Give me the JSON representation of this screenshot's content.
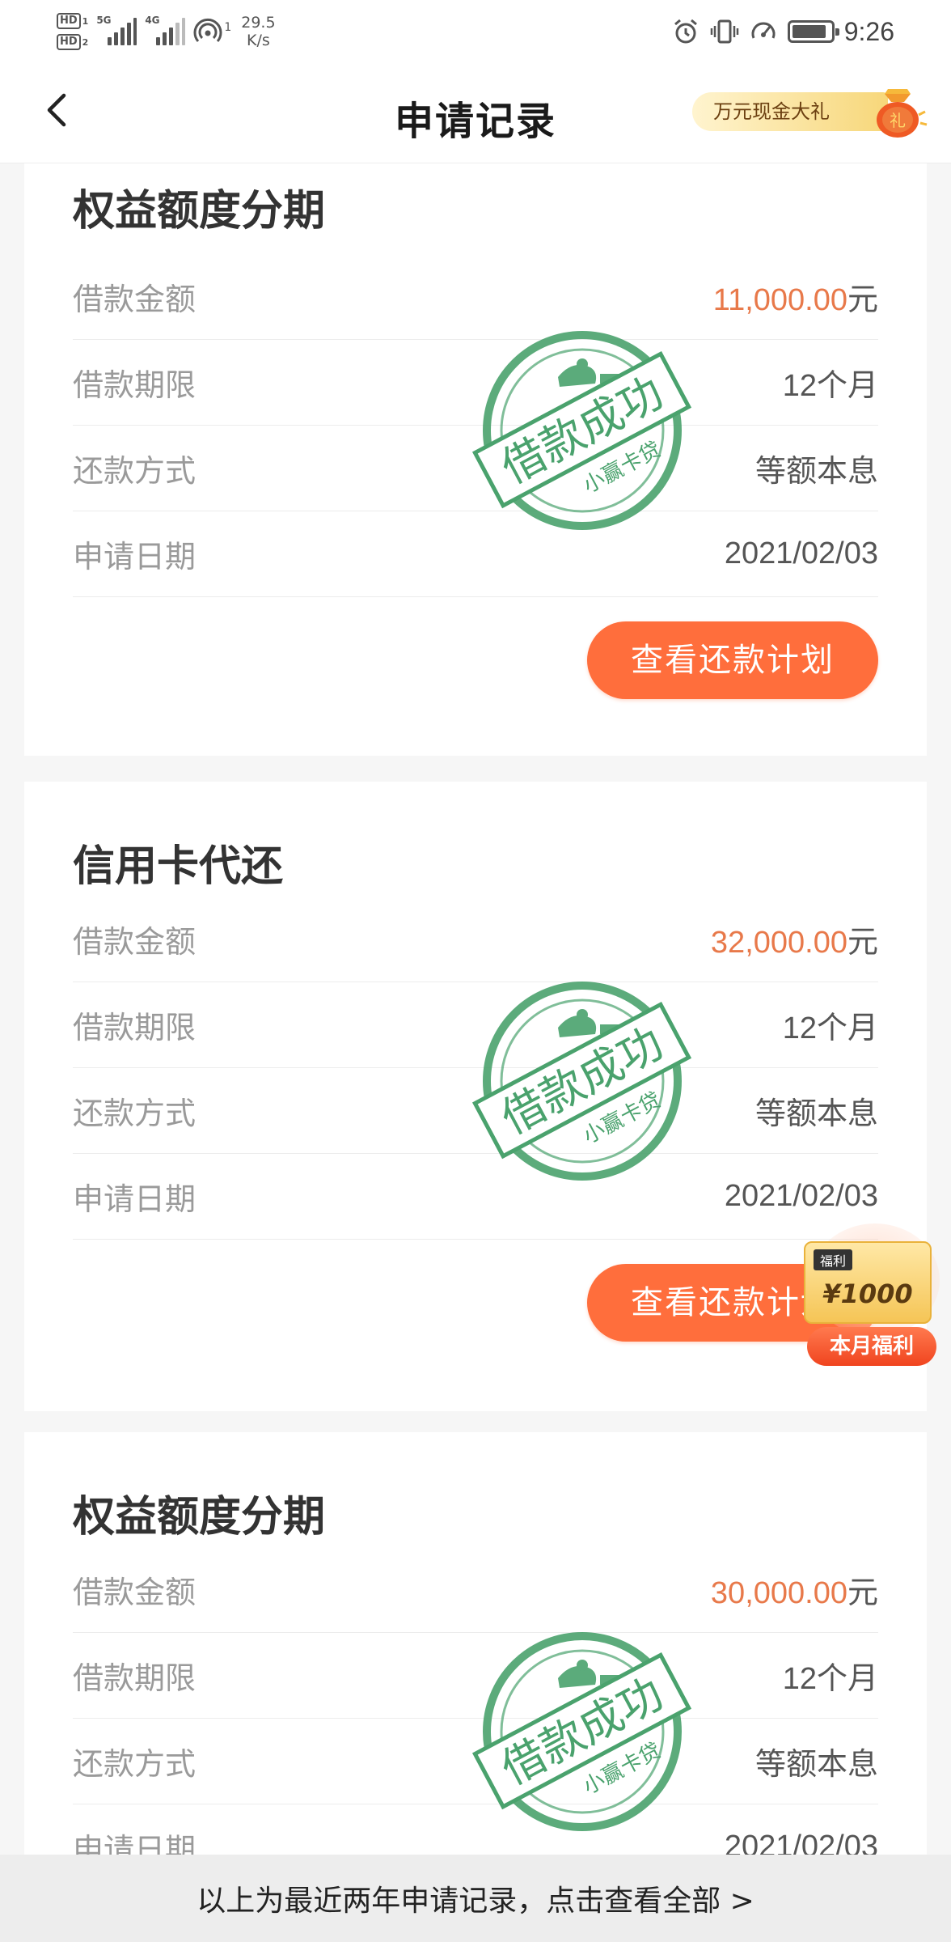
{
  "status_bar": {
    "hd1": "HD",
    "hd1_num": "1",
    "hd2": "HD",
    "hd2_num": "2",
    "net1": "5G",
    "net2": "4G",
    "speed_value": "29.5",
    "speed_unit": "K/s",
    "hotspot_count": "1",
    "battery_level": 0.9,
    "time": "9:26"
  },
  "header": {
    "title": "申请记录",
    "promo_label": "万元现金大礼",
    "promo_bag_char": "礼"
  },
  "labels": {
    "amount": "借款金额",
    "term": "借款期限",
    "method": "还款方式",
    "date": "申请日期",
    "unit": "元",
    "plan_button": "查看还款计划"
  },
  "stamp": {
    "main_text": "借款成功",
    "brand_text": "小赢卡贷",
    "color": "#4aa26d"
  },
  "records": [
    {
      "title": "权益额度分期",
      "amount": "11,000.00",
      "term": "12个月",
      "method": "等额本息",
      "date": "2021/02/03"
    },
    {
      "title": "信用卡代还",
      "amount": "32,000.00",
      "term": "12个月",
      "method": "等额本息",
      "date": "2021/02/03"
    },
    {
      "title": "权益额度分期",
      "amount": "30,000.00",
      "term": "12个月",
      "method": "等额本息",
      "date": "2021/02/03"
    }
  ],
  "welfare": {
    "tag": "福利",
    "amount": "¥1000",
    "ribbon": "本月福利"
  },
  "footer": {
    "text": "以上为最近两年申请记录，点击查看全部 >"
  },
  "colors": {
    "accent": "#ff6e3c",
    "amount_text": "#e8794a",
    "stamp": "#4aa26d"
  }
}
